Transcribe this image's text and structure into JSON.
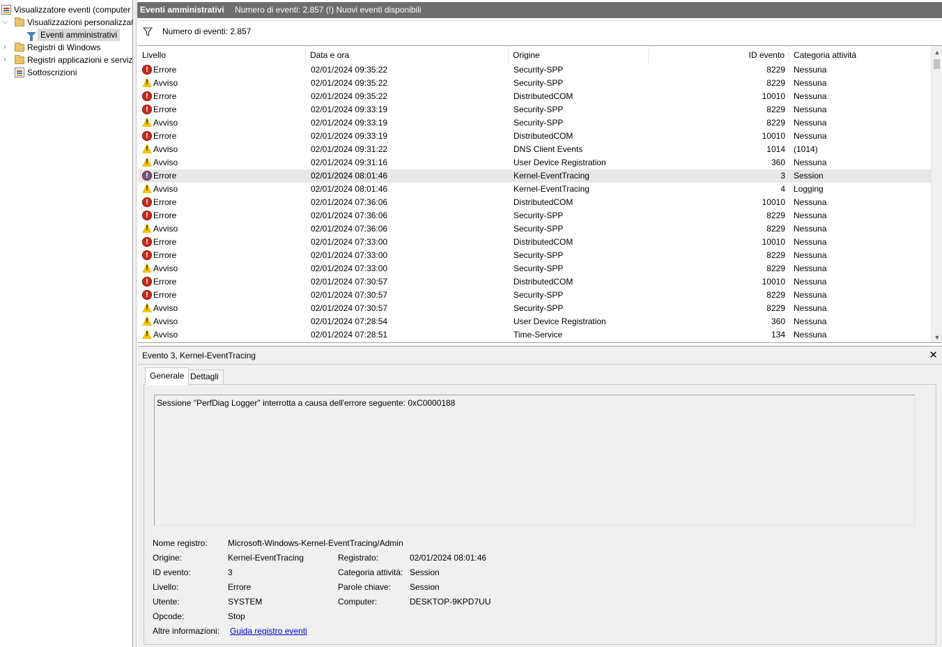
{
  "tree": {
    "root": "Visualizzatore eventi (computer",
    "custom_views": "Visualizzazioni personalizzate",
    "admin_events": "Eventi amministrativi",
    "windows_logs": "Registri di Windows",
    "app_services": "Registri applicazioni e servizi",
    "subscriptions": "Sottoscrizioni"
  },
  "header": {
    "title": "Eventi amministrativi",
    "info": "Numero di eventi: 2.857 (!) Nuovi eventi disponibili"
  },
  "filter": {
    "text": "Numero di eventi: 2.857"
  },
  "columns": {
    "level": "Livello",
    "date": "Data e ora",
    "source": "Origine",
    "event_id": "ID evento",
    "category": "Categoria attività"
  },
  "rows": [
    {
      "icon": "error-icon",
      "level": "Errore",
      "date": "02/01/2024 09:35:22",
      "source": "Security-SPP",
      "id": "8229",
      "category": "Nessuna"
    },
    {
      "icon": "warning-icon",
      "level": "Avviso",
      "date": "02/01/2024 09:35:22",
      "source": "Security-SPP",
      "id": "8229",
      "category": "Nessuna"
    },
    {
      "icon": "error-icon",
      "level": "Errore",
      "date": "02/01/2024 09:35:22",
      "source": "DistributedCOM",
      "id": "10010",
      "category": "Nessuna"
    },
    {
      "icon": "error-icon",
      "level": "Errore",
      "date": "02/01/2024 09:33:19",
      "source": "Security-SPP",
      "id": "8229",
      "category": "Nessuna"
    },
    {
      "icon": "warning-icon",
      "level": "Avviso",
      "date": "02/01/2024 09:33:19",
      "source": "Security-SPP",
      "id": "8229",
      "category": "Nessuna"
    },
    {
      "icon": "error-icon",
      "level": "Errore",
      "date": "02/01/2024 09:33:19",
      "source": "DistributedCOM",
      "id": "10010",
      "category": "Nessuna"
    },
    {
      "icon": "warning-icon",
      "level": "Avviso",
      "date": "02/01/2024 09:31:22",
      "source": "DNS Client Events",
      "id": "1014",
      "category": "(1014)"
    },
    {
      "icon": "warning-icon",
      "level": "Avviso",
      "date": "02/01/2024 09:31:16",
      "source": "User Device Registration",
      "id": "360",
      "category": "Nessuna"
    },
    {
      "icon": "error-icon",
      "level": "Errore",
      "date": "02/01/2024 08:01:46",
      "source": "Kernel-EventTracing",
      "id": "3",
      "category": "Session",
      "selected": true
    },
    {
      "icon": "warning-icon",
      "level": "Avviso",
      "date": "02/01/2024 08:01:46",
      "source": "Kernel-EventTracing",
      "id": "4",
      "category": "Logging"
    },
    {
      "icon": "error-icon",
      "level": "Errore",
      "date": "02/01/2024 07:36:06",
      "source": "DistributedCOM",
      "id": "10010",
      "category": "Nessuna"
    },
    {
      "icon": "error-icon",
      "level": "Errore",
      "date": "02/01/2024 07:36:06",
      "source": "Security-SPP",
      "id": "8229",
      "category": "Nessuna"
    },
    {
      "icon": "warning-icon",
      "level": "Avviso",
      "date": "02/01/2024 07:36:06",
      "source": "Security-SPP",
      "id": "8229",
      "category": "Nessuna"
    },
    {
      "icon": "error-icon",
      "level": "Errore",
      "date": "02/01/2024 07:33:00",
      "source": "DistributedCOM",
      "id": "10010",
      "category": "Nessuna"
    },
    {
      "icon": "error-icon",
      "level": "Errore",
      "date": "02/01/2024 07:33:00",
      "source": "Security-SPP",
      "id": "8229",
      "category": "Nessuna"
    },
    {
      "icon": "warning-icon",
      "level": "Avviso",
      "date": "02/01/2024 07:33:00",
      "source": "Security-SPP",
      "id": "8229",
      "category": "Nessuna"
    },
    {
      "icon": "error-icon",
      "level": "Errore",
      "date": "02/01/2024 07:30:57",
      "source": "DistributedCOM",
      "id": "10010",
      "category": "Nessuna"
    },
    {
      "icon": "error-icon",
      "level": "Errore",
      "date": "02/01/2024 07:30:57",
      "source": "Security-SPP",
      "id": "8229",
      "category": "Nessuna"
    },
    {
      "icon": "warning-icon",
      "level": "Avviso",
      "date": "02/01/2024 07:30:57",
      "source": "Security-SPP",
      "id": "8229",
      "category": "Nessuna"
    },
    {
      "icon": "warning-icon",
      "level": "Avviso",
      "date": "02/01/2024 07:28:54",
      "source": "User Device Registration",
      "id": "360",
      "category": "Nessuna"
    },
    {
      "icon": "warning-icon",
      "level": "Avviso",
      "date": "02/01/2024 07:28:51",
      "source": "Time-Service",
      "id": "134",
      "category": "Nessuna"
    }
  ],
  "detail": {
    "title": "Evento 3, Kernel-EventTracing",
    "close": "✕",
    "tab_general": "Generale",
    "tab_details": "Dettagli",
    "description": "Sessione \"PerfDiag Logger\" interrotta a causa dell'errore seguente: 0xC0000188",
    "props": {
      "log_name_label": "Nome registro:",
      "log_name": "Microsoft-Windows-Kernel-EventTracing/Admin",
      "source_label": "Origine:",
      "source": "Kernel-EventTracing",
      "logged_label": "Registrato:",
      "logged": "02/01/2024 08:01:46",
      "event_id_label": "ID evento:",
      "event_id": "3",
      "category_label": "Categoria attività:",
      "category": "Session",
      "level_label": "Livello:",
      "level": "Errore",
      "keywords_label": "Parole chiave:",
      "keywords": "Session",
      "user_label": "Utente:",
      "user": "SYSTEM",
      "computer_label": "Computer:",
      "computer": "DESKTOP-9KPD7UU",
      "opcode_label": "Opcode:",
      "opcode": "Stop",
      "more_info_label": "Altre informazioni:",
      "more_info_link": "Guida registro eventi"
    }
  },
  "colors": {
    "header_bg": "#6d6d6d",
    "error": "#c42b1c",
    "warning": "#f2c40f",
    "link": "#0000cc",
    "selected_row": "#e8e8e8"
  }
}
